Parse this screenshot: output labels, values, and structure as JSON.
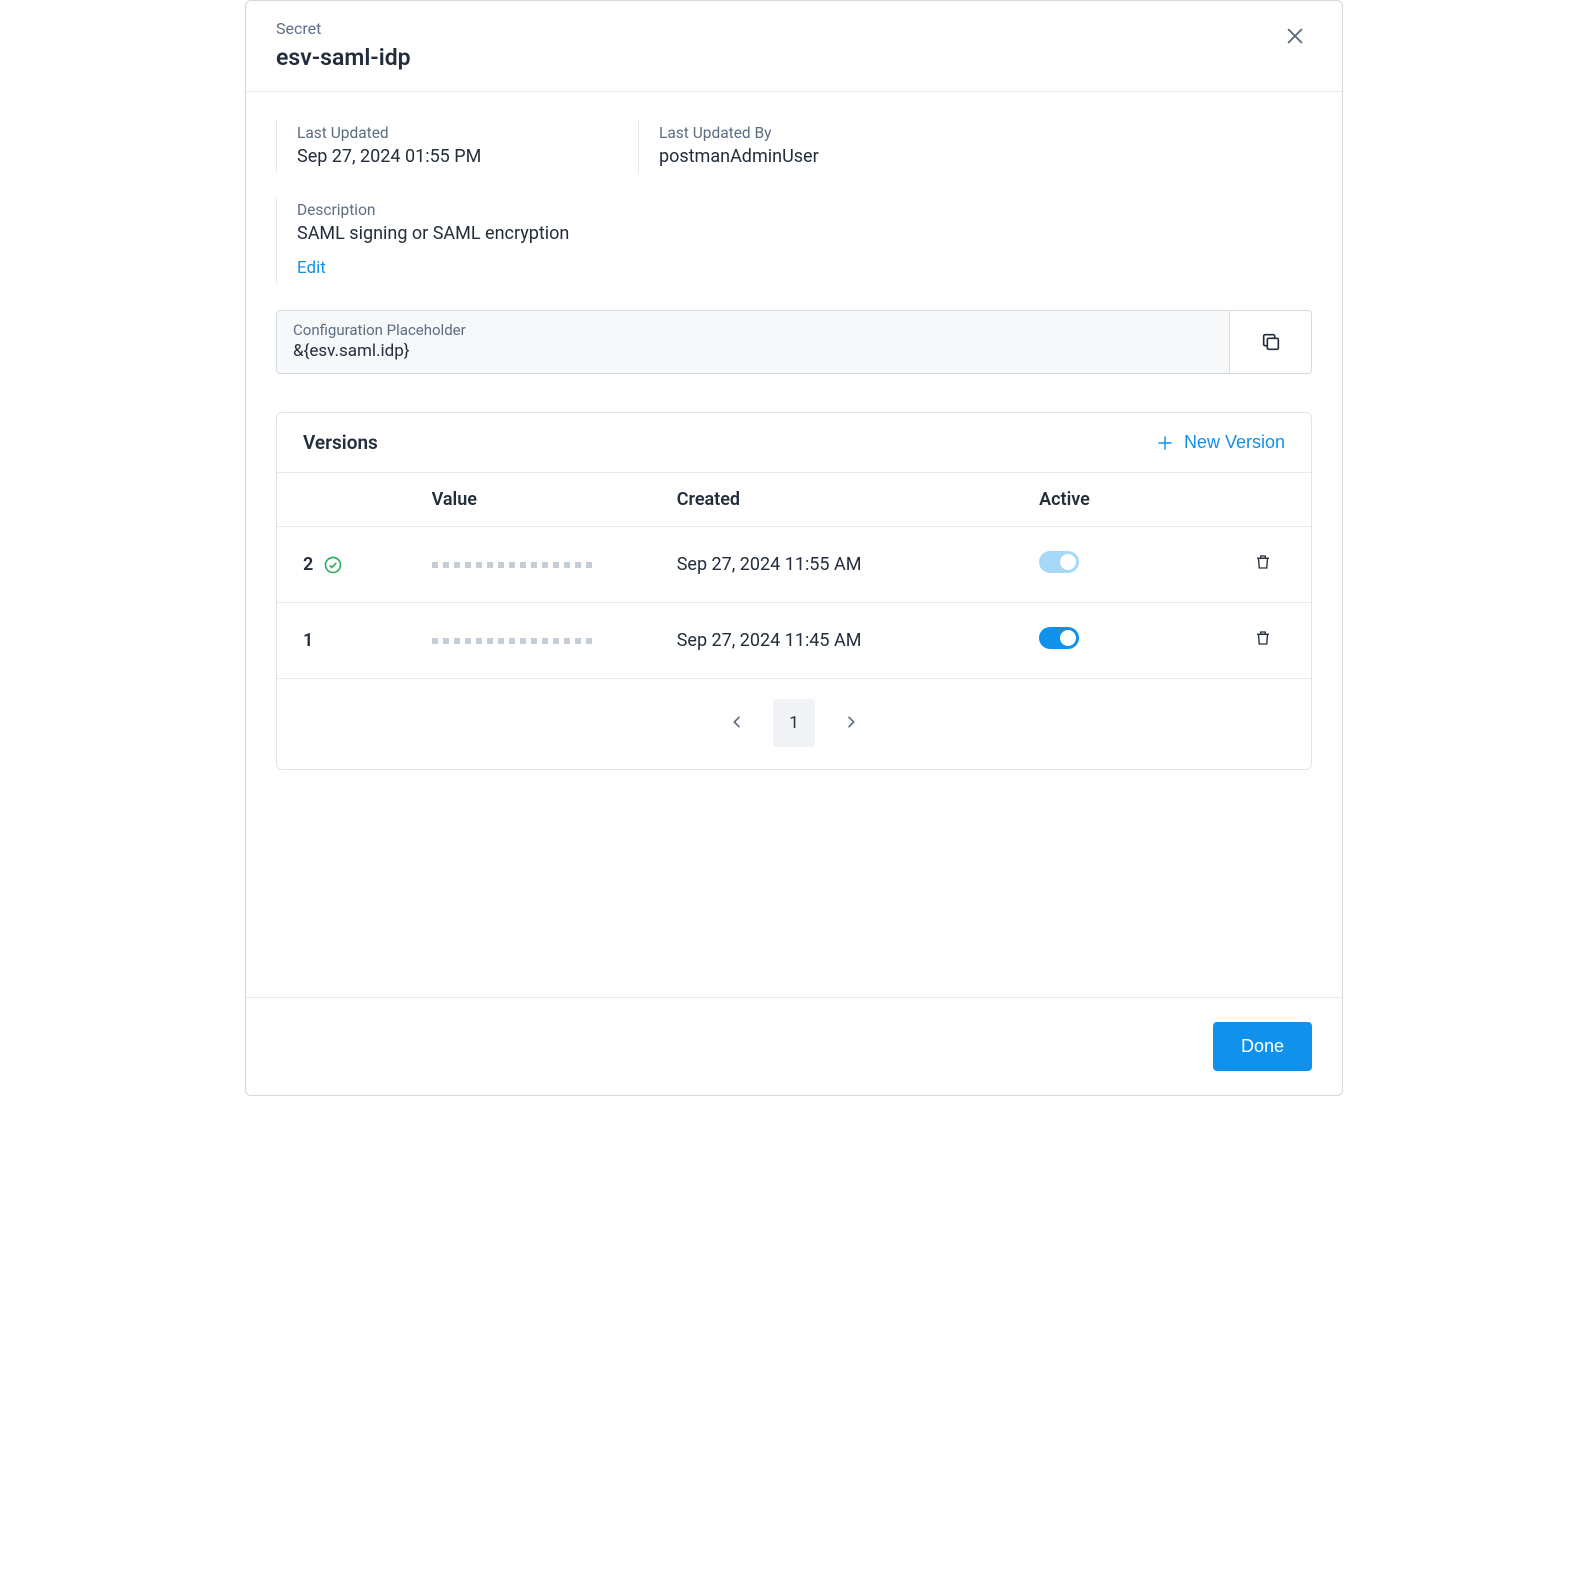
{
  "header": {
    "eyebrow": "Secret",
    "title": "esv-saml-idp"
  },
  "meta": {
    "last_updated_label": "Last Updated",
    "last_updated_value": "Sep 27, 2024 01:55 PM",
    "last_updated_by_label": "Last Updated By",
    "last_updated_by_value": "postmanAdminUser",
    "description_label": "Description",
    "description_value": "SAML signing or SAML encryption",
    "edit_label": "Edit"
  },
  "config": {
    "label": "Configuration Placeholder",
    "value": "&{esv.saml.idp}"
  },
  "versions": {
    "title": "Versions",
    "new_label": "New Version",
    "columns": {
      "number": "",
      "value": "Value",
      "created": "Created",
      "active": "Active",
      "actions": ""
    },
    "rows": [
      {
        "number": "2",
        "verified": true,
        "created": "Sep 27, 2024 11:55 AM",
        "active": true,
        "active_style": "light"
      },
      {
        "number": "1",
        "verified": false,
        "created": "Sep 27, 2024 11:45 AM",
        "active": true,
        "active_style": "solid"
      }
    ],
    "pagination": {
      "current": "1"
    }
  },
  "footer": {
    "done_label": "Done"
  }
}
